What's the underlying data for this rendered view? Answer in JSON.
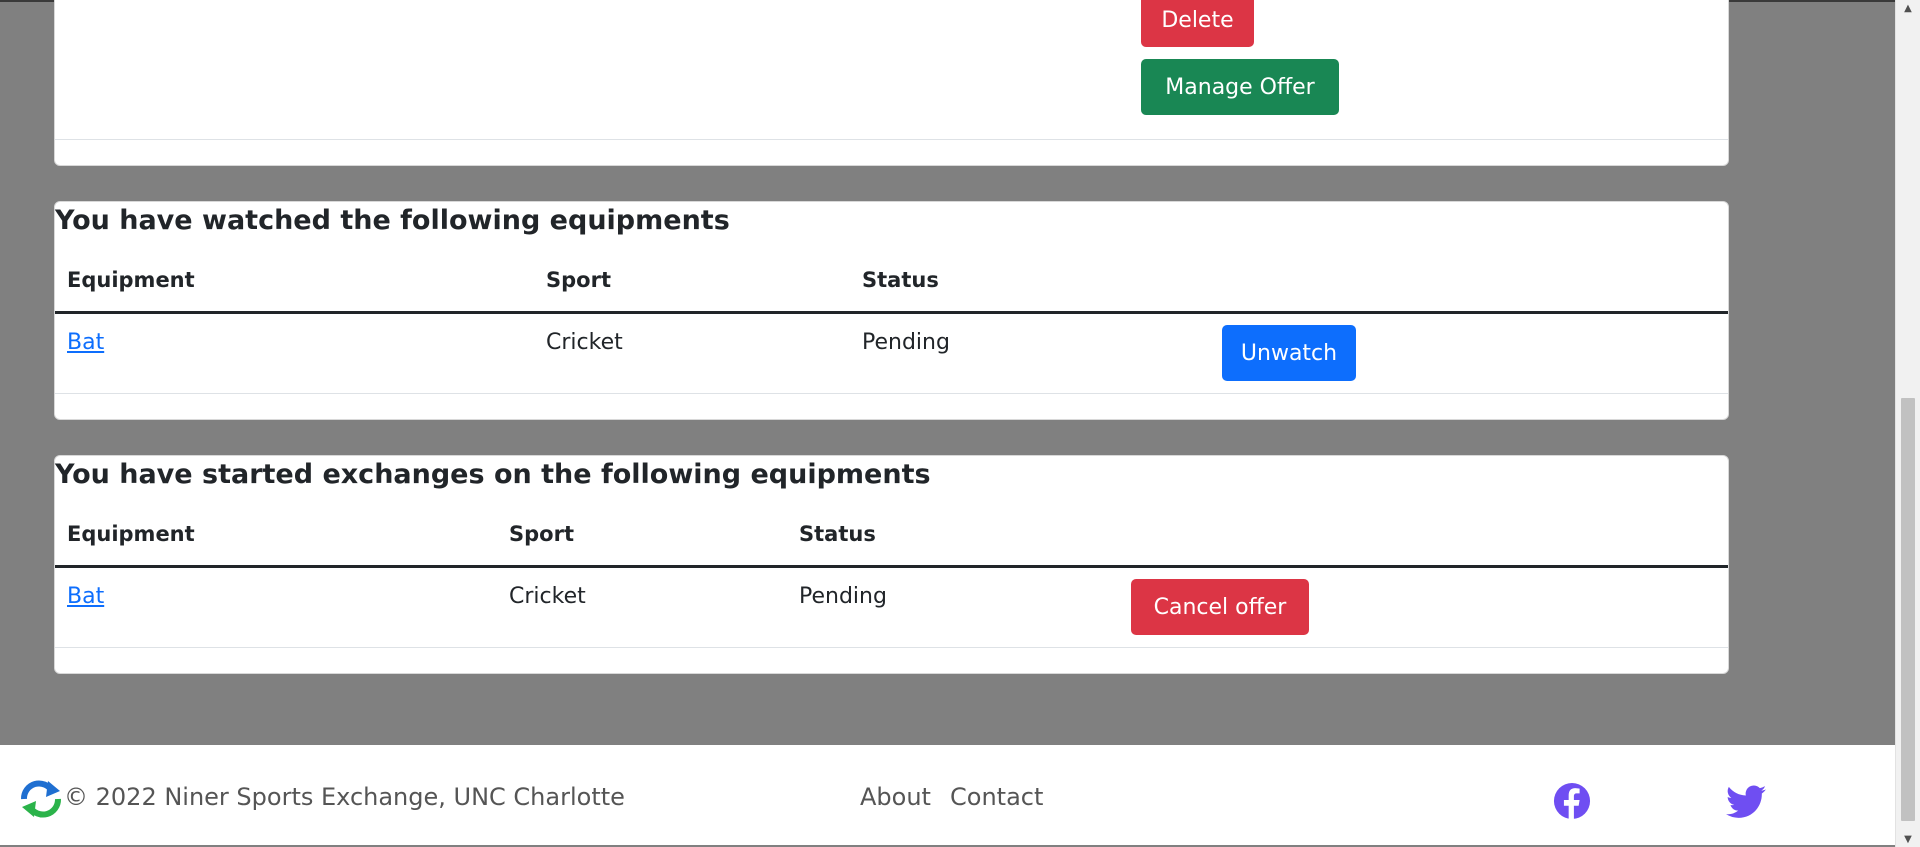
{
  "top_card": {
    "delete_label": "Delete",
    "manage_offer_label": "Manage Offer"
  },
  "watched": {
    "title": "You have watched the following equipments",
    "headers": [
      "Equipment",
      "Sport",
      "Status"
    ],
    "rows": [
      {
        "equipment": "Bat",
        "sport": "Cricket",
        "status": "Pending",
        "action": "Unwatch"
      }
    ]
  },
  "exchanges": {
    "title": "You have started exchanges on the following equipments",
    "headers": [
      "Equipment",
      "Sport",
      "Status"
    ],
    "rows": [
      {
        "equipment": "Bat",
        "sport": "Cricket",
        "status": "Pending",
        "action": "Cancel offer"
      }
    ]
  },
  "footer": {
    "copyright": "© 2022 Niner Sports Exchange, UNC Charlotte",
    "links": [
      "About",
      "Contact"
    ],
    "social": [
      "facebook-icon",
      "twitter-icon"
    ]
  },
  "colors": {
    "background": "#808080",
    "danger": "#dc3545",
    "success": "#198754",
    "primary": "#0d6efd",
    "social": "#6f4ef2"
  }
}
